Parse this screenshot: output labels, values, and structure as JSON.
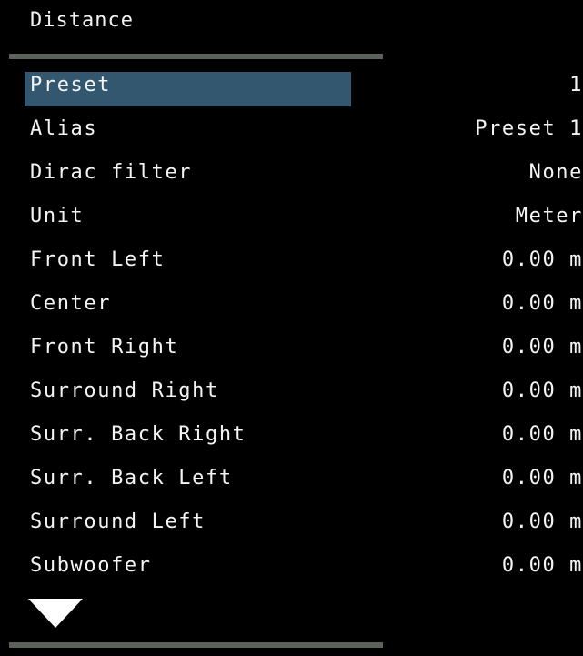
{
  "header": {
    "title": "Distance"
  },
  "settings": [
    {
      "label": "Preset",
      "value": "1",
      "selected": true
    },
    {
      "label": "Alias",
      "value": "Preset 1",
      "selected": false
    },
    {
      "label": "Dirac filter",
      "value": "None",
      "selected": false
    },
    {
      "label": "Unit",
      "value": "Meter",
      "selected": false
    },
    {
      "label": "Front Left",
      "value": "0.00 m",
      "selected": false
    },
    {
      "label": "Center",
      "value": "0.00 m",
      "selected": false
    },
    {
      "label": "Front Right",
      "value": "0.00 m",
      "selected": false
    },
    {
      "label": "Surround Right",
      "value": "0.00 m",
      "selected": false
    },
    {
      "label": "Surr. Back Right",
      "value": "0.00 m",
      "selected": false
    },
    {
      "label": "Surr. Back Left",
      "value": "0.00 m",
      "selected": false
    },
    {
      "label": "Surround Left",
      "value": "0.00 m",
      "selected": false
    },
    {
      "label": "Subwoofer",
      "value": "0.00 m",
      "selected": false
    }
  ],
  "icons": {
    "scroll_down": "triangle-down-icon"
  },
  "colors": {
    "background": "#000000",
    "text": "#f4f4f4",
    "selection": "#33576f",
    "divider": "#5b615b"
  }
}
